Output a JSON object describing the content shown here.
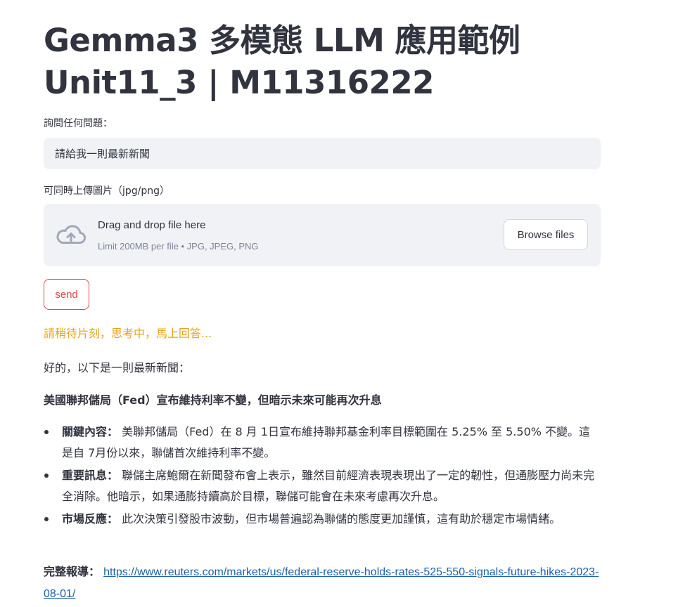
{
  "page": {
    "title_line1": "Gemma3 多模態 LLM 應用範例",
    "title_line2": "Unit11_3 | M11316222"
  },
  "question": {
    "label": "詢問任何問題：",
    "value": "請給我一則最新新聞"
  },
  "upload": {
    "label": "可同時上傳圖片（jpg/png）",
    "drop_title": "Drag and drop file here",
    "drop_hint": "Limit 200MB per file • JPG, JPEG, PNG",
    "browse_label": "Browse files",
    "icon": "cloud-upload-icon"
  },
  "send_label": "send",
  "status_text": "請稍待片刻，思考中，馬上回答...",
  "response": {
    "intro": "好的，以下是一則最新新聞：",
    "headline": "美國聯邦儲局（Fed）宣布維持利率不變，但暗示未來可能再次升息",
    "bullets": [
      {
        "key": "關鍵內容：",
        "text": "美聯邦儲局（Fed）在 8 月 1日宣布維持聯邦基金利率目標範圍在 5.25% 至 5.50% 不變。這是自 7月份以來，聯儲首次維持利率不變。"
      },
      {
        "key": "重要訊息：",
        "text": "聯儲主席鮑爾在新聞發布會上表示，雖然目前經濟表現表現出了一定的韌性，但通膨壓力尚未完全消除。他暗示，如果通膨持續高於目標，聯儲可能會在未來考慮再次升息。"
      },
      {
        "key": "市場反應：",
        "text": "此次決策引發股市波動，但市場普遍認為聯儲的態度更加謹慎，這有助於穩定市場情緒。"
      }
    ],
    "full_report_label": "完整報導：",
    "full_report_url": "https://www.reuters.com/markets/us/federal-reserve-holds-rates-525-550-signals-future-hikes-2023-08-01/"
  },
  "colors": {
    "accent_red": "#e0454b",
    "status_orange": "#e8a317",
    "link_blue": "#1f5fa8",
    "input_bg": "#f0f2f6"
  }
}
